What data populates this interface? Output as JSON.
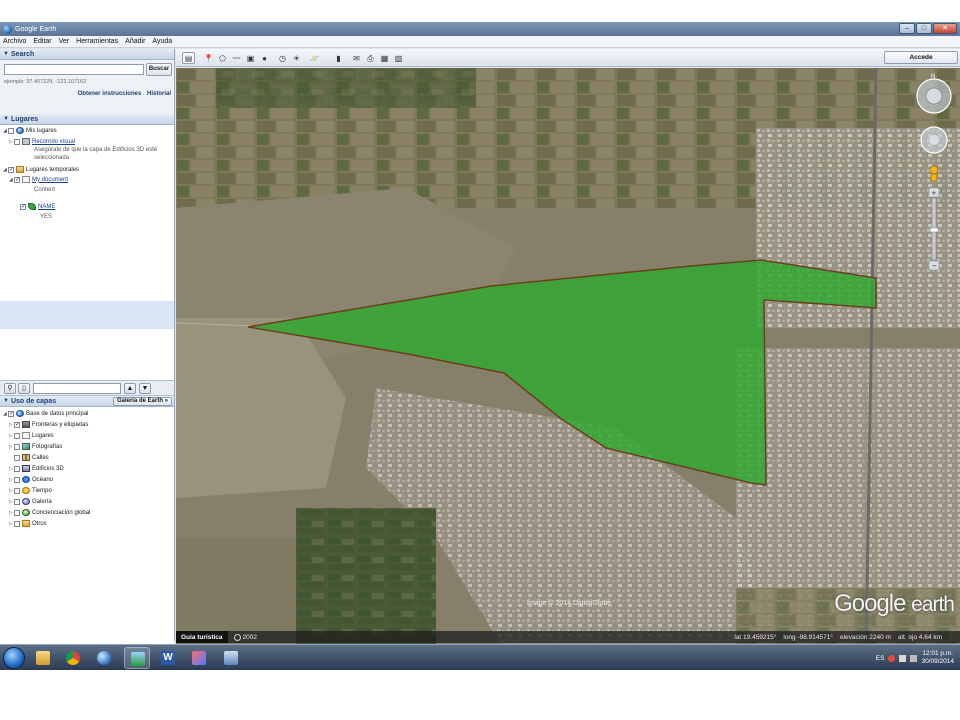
{
  "window": {
    "title": "Google Earth",
    "minimize": "–",
    "maximize": "□",
    "close": "✕"
  },
  "menu": [
    "Archivo",
    "Editar",
    "Ver",
    "Herramientas",
    "Añadir",
    "Ayuda"
  ],
  "search": {
    "header": "Search",
    "button": "Buscar",
    "hint": "ejemplo: 37.407229, -122.107162",
    "link_directions": "Obtener instrucciones",
    "link_history": "Historial"
  },
  "places": {
    "header": "Lugares",
    "my_places": "Mis lugares",
    "tour": "Recorrido visual",
    "tour_note_1": "Asegúrate de que la capa de Edificios 3D esté",
    "tour_note_2": "seleccionada",
    "temp_places": "Lugares temporales",
    "my_document": "My document",
    "content": "Content",
    "name_item": "NAME",
    "name_value": "YES"
  },
  "places_toolbar": {
    "up": "▲",
    "down": "▼"
  },
  "layers": {
    "header": "Uso de capas",
    "gallery_button": "Galería de Earth »",
    "items": [
      {
        "label": "Base de datos principal",
        "icon": "database-icon"
      },
      {
        "label": "Fronteras y etiquetas",
        "icon": "borders-icon"
      },
      {
        "label": "Lugares",
        "icon": "places-icon"
      },
      {
        "label": "Fotografías",
        "icon": "photos-icon"
      },
      {
        "label": "Calles",
        "icon": "roads-icon"
      },
      {
        "label": "Edificios 3D",
        "icon": "buildings-icon"
      },
      {
        "label": "Océano",
        "icon": "ocean-icon"
      },
      {
        "label": "Tiempo",
        "icon": "weather-icon"
      },
      {
        "label": "Galería",
        "icon": "gallery-icon"
      },
      {
        "label": "Concienciación global",
        "icon": "awareness-icon"
      },
      {
        "label": "Otros",
        "icon": "others-icon"
      }
    ]
  },
  "toolbar": {
    "login": "Accede"
  },
  "map": {
    "imagery_credit": "Image © 2014 DigitalGlobe",
    "logo_google": "Google",
    "logo_earth": "earth",
    "north": "N",
    "polygon_color": "#2fa82f"
  },
  "statusbar": {
    "tour_guide": "Guía turística",
    "year": "2002",
    "lat": "lat  19.459215°",
    "lon": "long -98.914571°",
    "elev": "elevación 2240 m",
    "eye": "alt. ojo  4.64 km"
  },
  "taskbar": {
    "lang": "ES",
    "time": "12:01 p.m.",
    "date": "30/09/2014"
  }
}
